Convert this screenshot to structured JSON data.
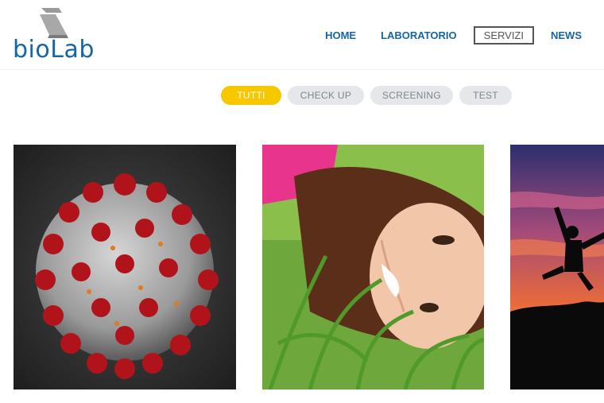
{
  "logo": {
    "text": "bioLab"
  },
  "nav": {
    "items": [
      {
        "label": "HOME",
        "active": false
      },
      {
        "label": "LABORATORIO",
        "active": false
      },
      {
        "label": "SERVIZI",
        "active": true
      },
      {
        "label": "NEWS",
        "active": false
      }
    ]
  },
  "filters": [
    {
      "label": "TUTTI",
      "active": true
    },
    {
      "label": "CHECK UP",
      "active": false
    },
    {
      "label": "SCREENING",
      "active": false
    },
    {
      "label": "TEST",
      "active": false
    }
  ],
  "colors": {
    "brand_blue": "#1466a8",
    "accent_yellow": "#f7c800",
    "pill_gray": "#e5e7ea"
  },
  "gallery": [
    {
      "subject": "virus-image"
    },
    {
      "subject": "woman-in-grass-image"
    },
    {
      "subject": "jumping-silhouette-image"
    }
  ]
}
